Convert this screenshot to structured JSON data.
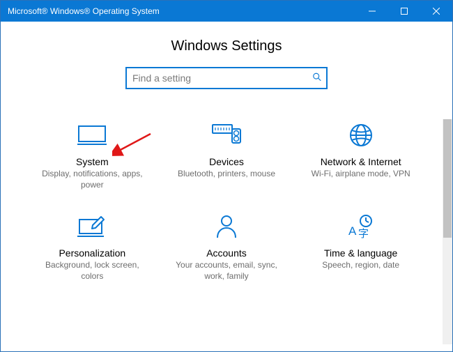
{
  "window": {
    "title": "Microsoft® Windows® Operating System"
  },
  "header": {
    "page_title": "Windows Settings"
  },
  "search": {
    "placeholder": "Find a setting"
  },
  "tiles": [
    {
      "title": "System",
      "sub": "Display, notifications, apps, power"
    },
    {
      "title": "Devices",
      "sub": "Bluetooth, printers, mouse"
    },
    {
      "title": "Network & Internet",
      "sub": "Wi-Fi, airplane mode, VPN"
    },
    {
      "title": "Personalization",
      "sub": "Background, lock screen, colors"
    },
    {
      "title": "Accounts",
      "sub": "Your accounts, email, sync, work, family"
    },
    {
      "title": "Time & language",
      "sub": "Speech, region, date"
    }
  ]
}
